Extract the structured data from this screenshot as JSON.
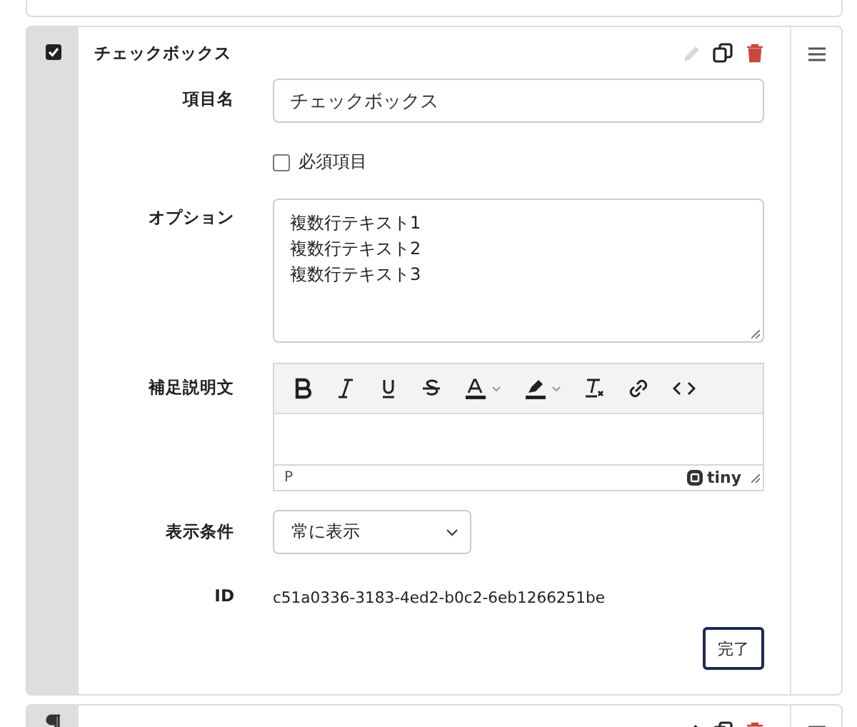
{
  "card": {
    "checked": true,
    "title": "チェックボックス",
    "edit_disabled": true,
    "rows": [
      {
        "kind": "text",
        "label": "項目名",
        "value": "チェックボックス"
      },
      {
        "kind": "checkbox",
        "label": "必須項目",
        "checked": false
      },
      {
        "kind": "textarea",
        "label": "オプション",
        "value": "複数行テキスト1\n複数行テキスト2\n複数行テキスト3"
      },
      {
        "kind": "editor",
        "label": "補足説明文",
        "path": "P",
        "brand": "tiny"
      },
      {
        "kind": "select",
        "label": "表示条件",
        "value": "常に表示"
      },
      {
        "kind": "static",
        "label": "ID",
        "value": "c51a0336-3183-4ed2-b0c2-6eb1266251be"
      }
    ],
    "done_button": "完了"
  }
}
